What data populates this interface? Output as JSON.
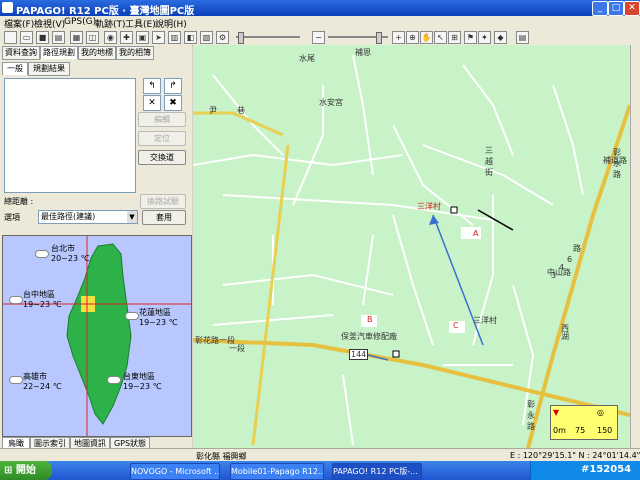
{
  "window": {
    "title": "PAPAGO! R12 PC版 · 臺灣地圖PC版"
  },
  "menu": [
    "檔案(F)",
    "檢視(V)",
    "GPS(G)",
    "軌跡(T)",
    "工具(E)",
    "說明(H)"
  ],
  "toolbar": {
    "icons": [
      "new-icon",
      "open-icon",
      "save-icon",
      "print-icon",
      "print-preview-icon",
      "zoom-minus-icon",
      "zoom-plus-icon",
      "pan-hand-icon",
      "route-icon",
      "layers-icon"
    ]
  },
  "left_panel": {
    "tabs": [
      "資料查詢",
      "路徑規劃",
      "我的地標",
      "我的相簿"
    ],
    "subtabs": [
      "一般",
      "規劃結果"
    ],
    "buttons": {
      "edit": "編輯",
      "locate": "定位",
      "exchange": "交換道",
      "route_opt": "換路試驗",
      "set": "套用"
    },
    "total_distance_label": "總距離 :",
    "option_label": "選項",
    "option_value": "最佳路徑(建議)",
    "weather": [
      {
        "city": "台北市",
        "temp": "20~23 ℃"
      },
      {
        "city": "台中地區",
        "temp": "19~23 ℃"
      },
      {
        "city": "花蓮地區",
        "temp": "19~23 ℃"
      },
      {
        "city": "高雄市",
        "temp": "22~24 ℃"
      },
      {
        "city": "台東地區",
        "temp": "19~23 ℃"
      }
    ],
    "bottom_tabs": [
      "鳥瞰",
      "圖示索引",
      "地圖資訊",
      "GPS狀態"
    ]
  },
  "map": {
    "labels": {
      "road1": "補恩",
      "road2": "水尾",
      "temple": "水安宮",
      "street1": "三越街",
      "road3": "彰水路",
      "road4": "一段",
      "village1": "三洋村",
      "village2": "三洋村",
      "road_flower": "彰花路一段",
      "shop": "保釜汽車修配廠",
      "route_num": "144",
      "road5": "彰永路",
      "road6": "中山路",
      "extra1": "尹",
      "extra2": "巷",
      "extra3": "路",
      "marker_a": "A",
      "marker_b": "B",
      "marker_c": "C",
      "road7": "補道路",
      "num1": "6",
      "num2": "4",
      "num3": "3",
      "west": "西",
      "hu": "湖"
    },
    "scale": {
      "min": "0m",
      "mid": "75",
      "max": "150"
    }
  },
  "statusbar": {
    "location": "彰化縣 福興鄉",
    "coords": "E : 120°29'15.1\"  N : 24°01'14.4\""
  },
  "taskbar": {
    "start": "開始",
    "tasks": [
      "NOVOGO - Microsoft ...",
      "Mobile01-Papago R12...",
      "PAPAGO! R12 PC版-..."
    ],
    "tray_text": "#152054"
  }
}
